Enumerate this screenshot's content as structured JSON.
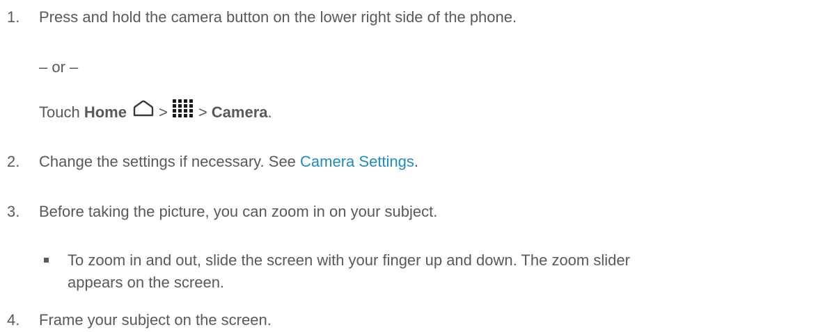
{
  "steps": [
    {
      "number": "1.",
      "text": "Press and hold the camera button on the lower right side of the phone.",
      "separator": "– or –",
      "alt": {
        "prefix": "Touch ",
        "home_label": "Home",
        "icon_home": "home-icon",
        "sep1": ">",
        "icon_apps": "apps-grid-icon",
        "sep2": ">",
        "camera_label": "Camera",
        "suffix": "."
      }
    },
    {
      "number": "2.",
      "text": "Change the settings if necessary. See ",
      "link": "Camera Settings",
      "suffix": "."
    },
    {
      "number": "3.",
      "text": "Before taking the picture, you can zoom in on your subject.",
      "bullet": {
        "line1": "To zoom in and out, slide the screen with your finger up and down. The zoom slider",
        "line2": "appears on the screen."
      }
    },
    {
      "number": "4.",
      "text": "Frame your subject on the screen."
    }
  ],
  "colors": {
    "text": "#595959",
    "link": "#1e8bc3"
  }
}
